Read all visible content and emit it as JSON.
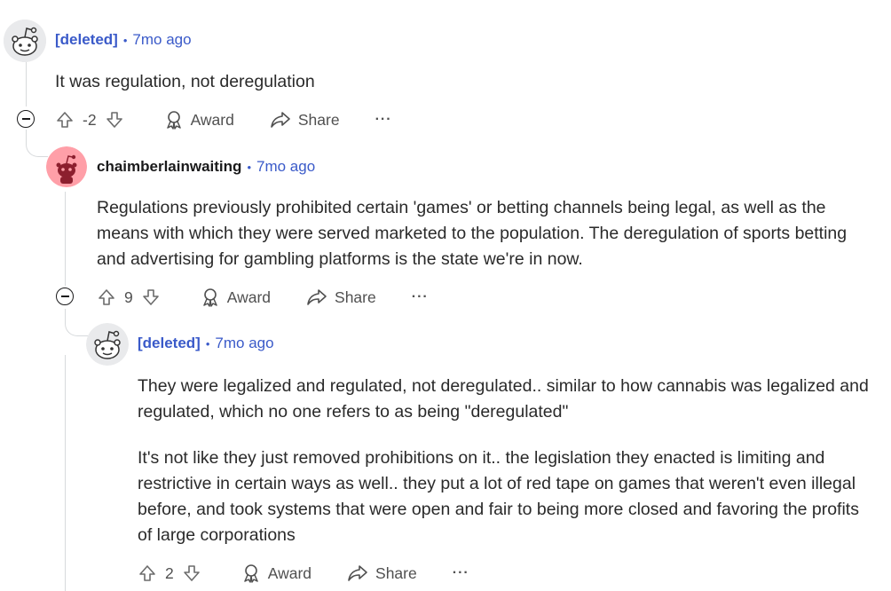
{
  "comments": [
    {
      "author": "[deleted]",
      "time": "7mo ago",
      "body": [
        "It was regulation, not deregulation"
      ],
      "score": "-2",
      "award_label": "Award",
      "share_label": "Share",
      "more_label": "···"
    },
    {
      "author": "chaimberlainwaiting",
      "time": "7mo ago",
      "body": [
        "Regulations previously prohibited certain 'games' or betting channels being legal, as well as the means with which they were served marketed to the population. The deregulation of sports betting and advertising for gambling platforms is the state we're in now."
      ],
      "score": "9",
      "award_label": "Award",
      "share_label": "Share",
      "more_label": "···"
    },
    {
      "author": "[deleted]",
      "time": "7mo ago",
      "body": [
        "They were legalized and regulated, not deregulated.. similar to how cannabis was legalized and regulated, which no one refers to as being \"deregulated\"",
        "It's not like they just removed prohibitions on it.. the legislation they enacted is limiting and restrictive in certain ways as well.. they put a lot of red tape on games that weren't even illegal before, and took systems that were open and fair to being more closed and favoring the profits of large corporations"
      ],
      "score": "2",
      "award_label": "Award",
      "share_label": "Share",
      "more_label": "···"
    }
  ],
  "separator": "•",
  "colors": {
    "meta_blue": "#3a5ac9",
    "thread_line": "#d7dadc",
    "avatar_pink": "#ff9fa8"
  },
  "icons": [
    "upvote-icon",
    "downvote-icon",
    "award-icon",
    "share-icon",
    "collapse-icon",
    "snoo-avatar-icon"
  ]
}
